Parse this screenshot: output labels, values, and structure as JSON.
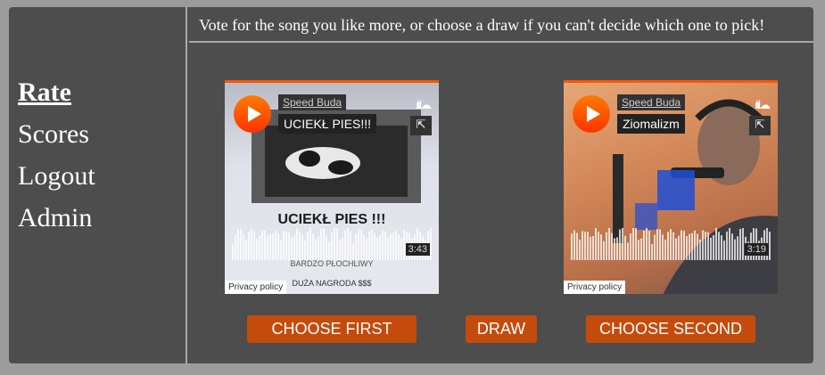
{
  "nav": {
    "items": [
      {
        "label": "Rate",
        "active": true
      },
      {
        "label": "Scores",
        "active": false
      },
      {
        "label": "Logout",
        "active": false
      },
      {
        "label": "Admin",
        "active": false
      }
    ]
  },
  "header": {
    "text": "Vote for the song you like more, or choose a draw if you can't decide which one to pick!"
  },
  "players": [
    {
      "artist": "Speed Buda",
      "title": "UCIEKŁ PIES!!!",
      "duration": "3:43",
      "privacy": "Privacy policy",
      "art_text": {
        "headline": "UCIEKŁ PIES !!!",
        "line1": "BARDZO PŁOCHLIWY",
        "line2": "DUŻA NAGRODA $$$"
      }
    },
    {
      "artist": "Speed Buda",
      "title": "Ziomalizm",
      "duration": "3:19",
      "privacy": "Privacy policy"
    }
  ],
  "buttons": {
    "choose_first": "CHOOSE FIRST",
    "draw": "DRAW",
    "choose_second": "CHOOSE SECOND"
  },
  "colors": {
    "page_bg": "#9c9c9c",
    "panel_bg": "#4d4d4d",
    "accent": "#ff5500",
    "button_bg": "#c44b0c"
  },
  "icons": {
    "play": "play-icon",
    "soundcloud": "soundcloud-logo-icon",
    "share": "share-icon"
  }
}
